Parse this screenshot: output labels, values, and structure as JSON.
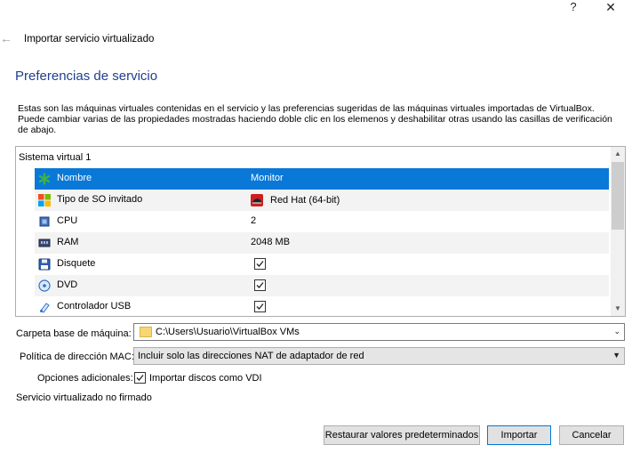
{
  "window": {
    "help_label": "?",
    "close_label": "✕"
  },
  "wizard": {
    "back_icon": "back-arrow-icon",
    "title": "Importar servicio virtualizado",
    "section_title": "Preferencias de servicio",
    "description": "Estas son las máquinas virtuales contenidas en el servicio y las preferencias sugeridas de las máquinas virtuales importadas de VirtualBox. Puede cambiar varias de las propiedades mostradas haciendo doble clic en los elemenos y deshabilitar otras usando las casillas de verificación de abajo."
  },
  "tree": {
    "header": "Sistema virtual 1",
    "rows": [
      {
        "icon": "name-icon",
        "name": "Nombre",
        "value": "Monitor",
        "type": "text",
        "selected": true
      },
      {
        "icon": "os-type-icon",
        "name": "Tipo de SO invitado",
        "value": "Red Hat (64-bit)",
        "type": "os"
      },
      {
        "icon": "cpu-icon",
        "name": "CPU",
        "value": "2",
        "type": "text"
      },
      {
        "icon": "ram-icon",
        "name": "RAM",
        "value": "2048 MB",
        "type": "text"
      },
      {
        "icon": "floppy-icon",
        "name": "Disquete",
        "value": true,
        "type": "check"
      },
      {
        "icon": "dvd-icon",
        "name": "DVD",
        "value": true,
        "type": "check"
      },
      {
        "icon": "usb-icon",
        "name": "Controlador USB",
        "value": true,
        "type": "check"
      }
    ]
  },
  "form": {
    "base_folder_label": "Carpeta base de máquina:",
    "base_folder_value": "C:\\Users\\Usuario\\VirtualBox VMs",
    "mac_policy_label": "Política de dirección MAC:",
    "mac_policy_value": "Incluir solo las direcciones NAT de adaptador de red",
    "extra_options_label": "Opciones adicionales:",
    "import_vdi_label": "Importar discos como VDI",
    "import_vdi_checked": true,
    "signature_status": "Servicio virtualizado no firmado"
  },
  "buttons": {
    "restore_defaults": "Restaurar valores predeterminados",
    "import": "Importar",
    "cancel": "Cancelar"
  },
  "colors": {
    "accent": "#0a78d7",
    "section_title": "#1f3f8f"
  }
}
